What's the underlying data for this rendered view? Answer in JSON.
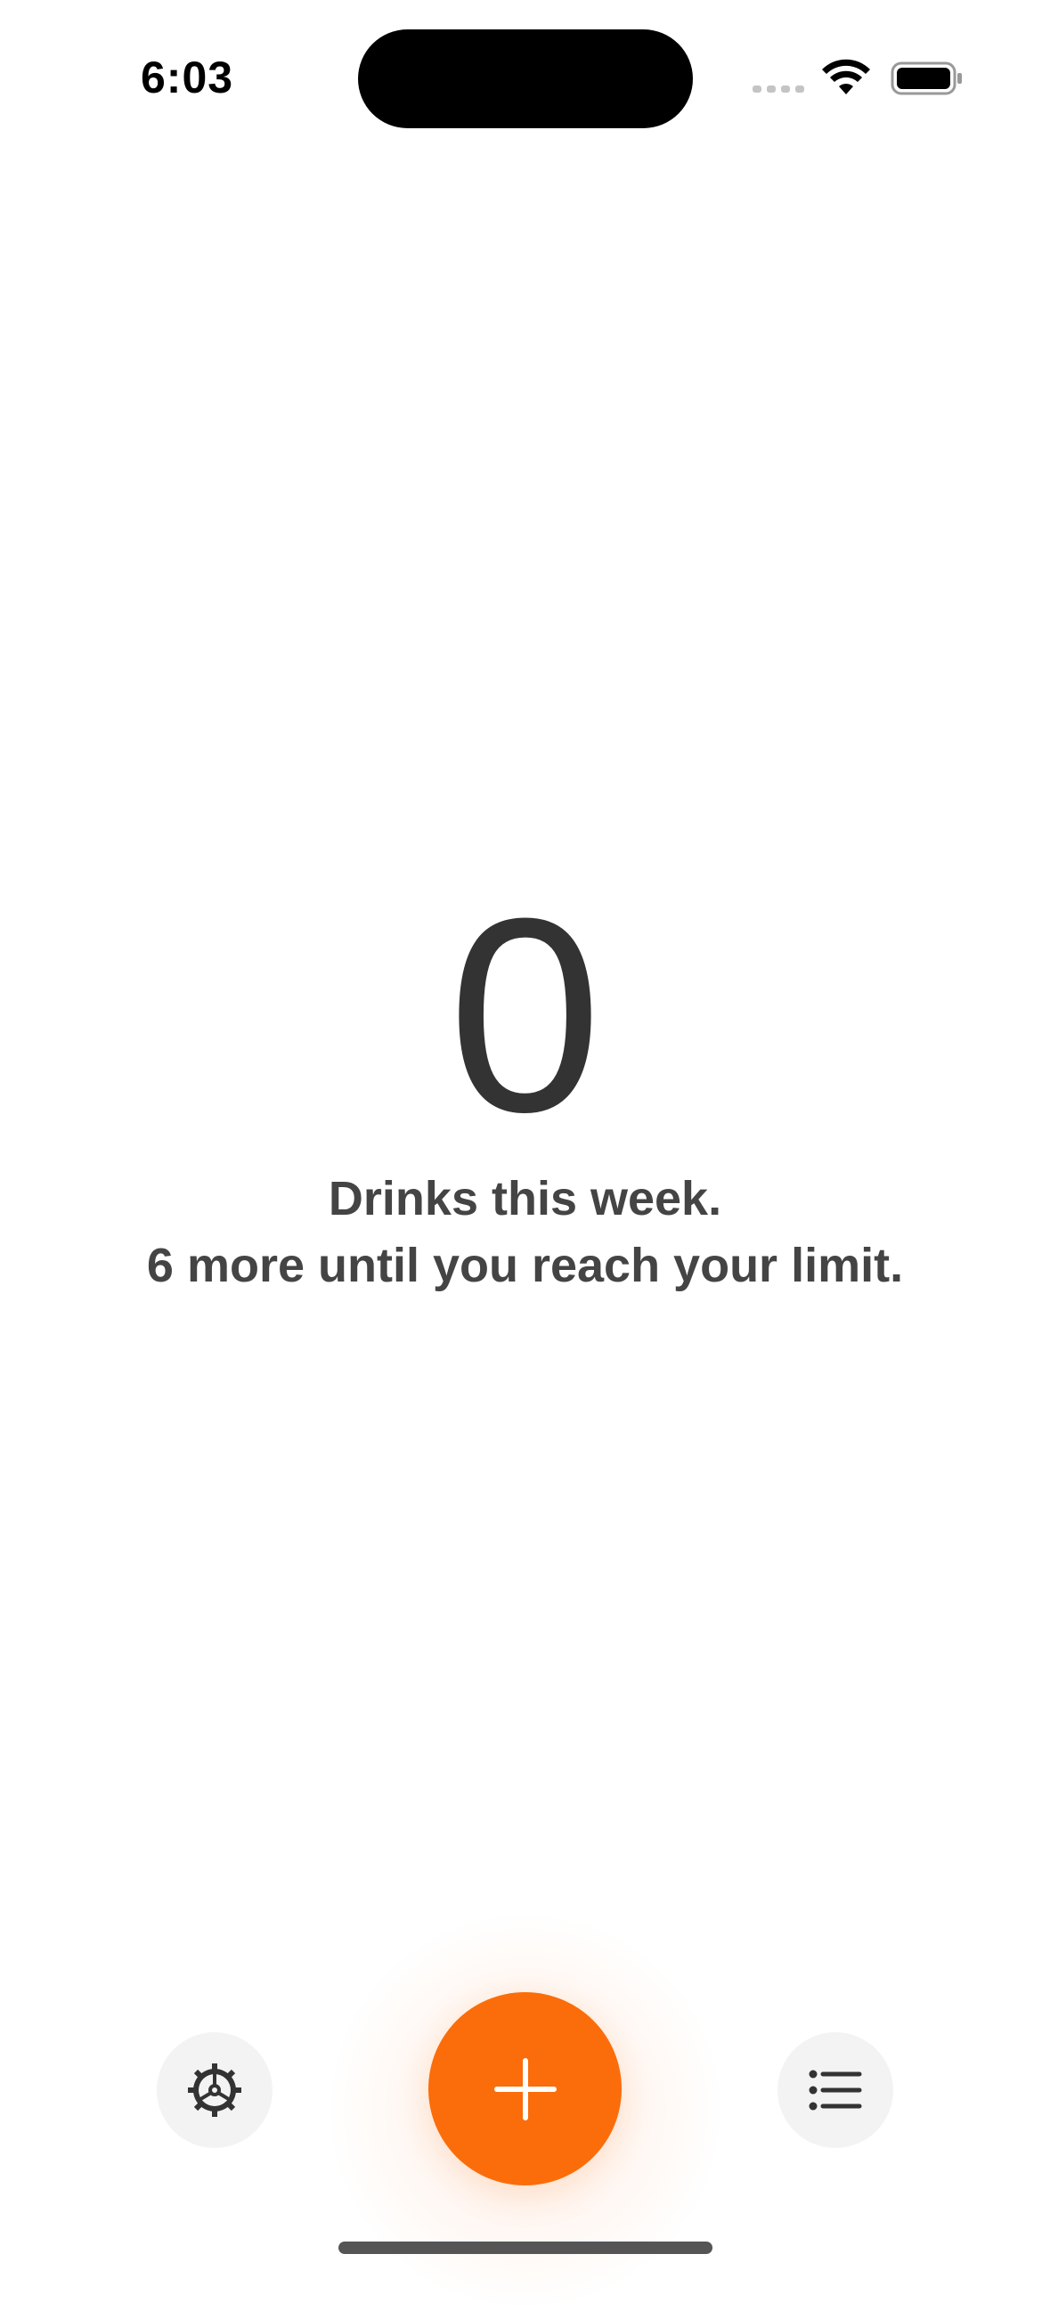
{
  "status_bar": {
    "time": "6:03"
  },
  "main": {
    "count": "0",
    "line1": "Drinks this week.",
    "line2": "6 more until you reach your limit."
  },
  "toolbar": {
    "settings_icon": "gear-icon",
    "add_icon": "plus-icon",
    "list_icon": "list-icon"
  },
  "colors": {
    "accent": "#fb6d0a",
    "text": "#333333",
    "button_bg": "#f3f3f3"
  }
}
